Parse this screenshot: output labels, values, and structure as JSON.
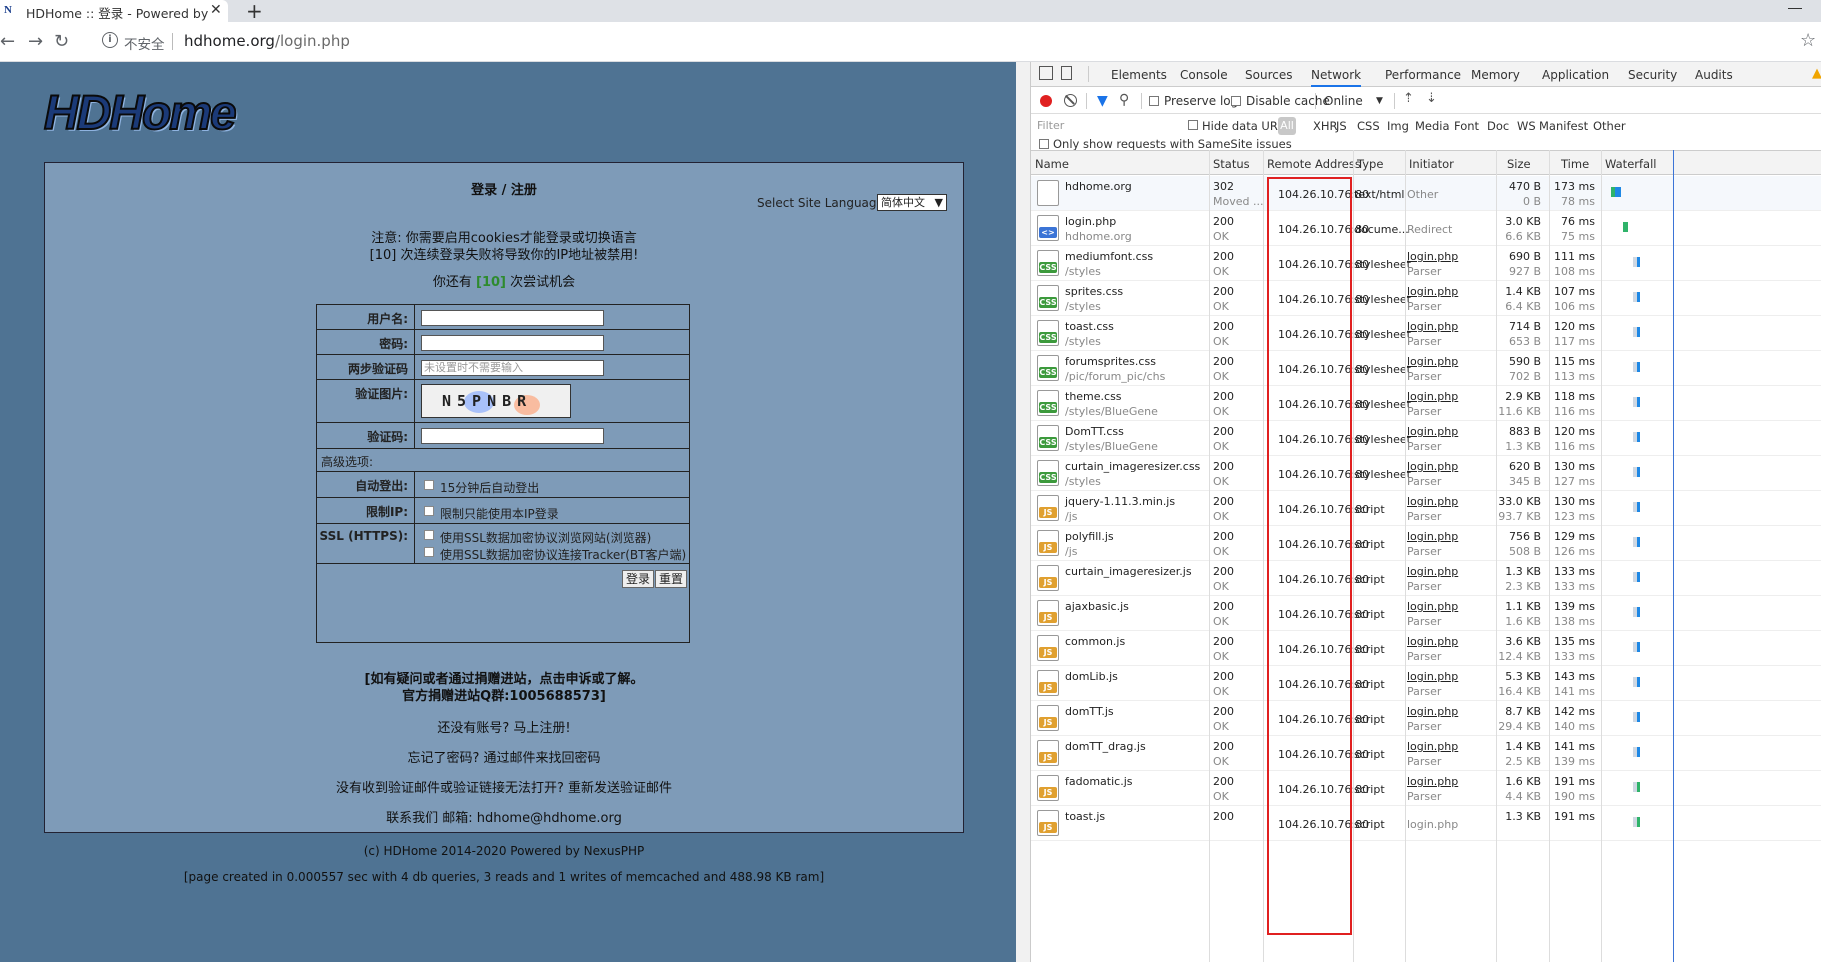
{
  "browser": {
    "tab_title": "HDHome :: 登录 - Powered by",
    "tab_close": "✕",
    "new_tab": "+",
    "security_label": "不安全",
    "url_host": "hdhome.org",
    "url_path": "/login.php"
  },
  "page": {
    "logo_text": "HDHome",
    "heading": "登录 / 注册",
    "lang_label": "Select Site Language:",
    "lang_value": "简体中文",
    "note_line1": "注意: 你需要启用cookies才能登录或切换语言",
    "note_line2": "[10] 次连续登录失败将导致你的IP地址被禁用!",
    "attempts_prefix": "你还有 ",
    "attempts_count": "[10]",
    "attempts_suffix": " 次尝试机会",
    "form": {
      "username_label": "用户名:",
      "password_label": "密码:",
      "twofa_label": "两步验证码",
      "twofa_placeholder": "未设置时不需要输入",
      "captcha_label": "验证图片:",
      "captcha_text": "N5PNBR",
      "code_label": "验证码:",
      "advanced_label": "高级选项:",
      "autologout_label": "自动登出:",
      "autologout_option": "15分钟后自动登出",
      "iplock_label": "限制IP:",
      "iplock_option": "限制只能使用本IP登录",
      "ssl_label": "SSL (HTTPS):",
      "ssl_option1": "使用SSL数据加密协议浏览网站(浏览器)",
      "ssl_option2": "使用SSL数据加密协议连接Tracker(BT客户端)",
      "login_button": "登录",
      "reset_button": "重置"
    },
    "appeal_line1": "[如有疑问或者通过捐赠进站，点击申诉或了解。",
    "appeal_line2": "官方捐赠进站Q群:1005688573]",
    "register_text": "还没有账号? 马上注册!",
    "forgot_text": "忘记了密码? 通过邮件来找回密码",
    "resend_text": "没有收到验证邮件或验证链接无法打开? 重新发送验证邮件",
    "contact_text": "联系我们 邮箱: hdhome@hdhome.org",
    "copyright": "(c) HDHome 2014-2020 Powered by NexusPHP",
    "page_stats": "[page created in 0.000557 sec with 4 db queries, 3 reads and 1 writes of memcached and 488.98 KB ram]"
  },
  "devtools": {
    "tabs": [
      "Elements",
      "Console",
      "Sources",
      "Network",
      "Performance",
      "Memory",
      "Application",
      "Security",
      "Audits"
    ],
    "active_tab": "Network",
    "toolbar": {
      "preserve_log": "Preserve log",
      "disable_cache": "Disable cache",
      "throttle": "Online"
    },
    "filter": {
      "placeholder": "Filter",
      "hide_data_urls": "Hide data URLs",
      "types": [
        "All",
        "XHR",
        "JS",
        "CSS",
        "Img",
        "Media",
        "Font",
        "Doc",
        "WS",
        "Manifest",
        "Other"
      ],
      "samesite": "Only show requests with SameSite issues"
    },
    "columns": [
      "Name",
      "Status",
      "Remote Address",
      "Type",
      "Initiator",
      "Size",
      "Time",
      "Waterfall"
    ],
    "requests": [
      {
        "name": "hdhome.org",
        "path": "",
        "status": "302",
        "status_text": "Moved ...",
        "addr": "104.26.10.76:80",
        "type": "text/html",
        "initiator": "Other",
        "initiator_sub": "",
        "size1": "470 B",
        "size2": "0 B",
        "time1": "173 ms",
        "time2": "78 ms",
        "icon": "doc",
        "wf": 0.02
      },
      {
        "name": "login.php",
        "path": "hdhome.org",
        "status": "200",
        "status_text": "OK",
        "addr": "104.26.10.76:80",
        "type": "docume...",
        "initiator": "Redirect",
        "initiator_sub": "",
        "size1": "3.0 KB",
        "size2": "6.6 KB",
        "time1": "76 ms",
        "time2": "75 ms",
        "icon": "html",
        "wf": 0.18
      },
      {
        "name": "mediumfont.css",
        "path": "/styles",
        "status": "200",
        "status_text": "OK",
        "addr": "104.26.10.76:80",
        "type": "stylesheet",
        "initiator": "login.php",
        "initiator_sub": "Parser",
        "size1": "690 B",
        "size2": "927 B",
        "time1": "111 ms",
        "time2": "108 ms",
        "icon": "css",
        "wf": 0.3
      },
      {
        "name": "sprites.css",
        "path": "/styles",
        "status": "200",
        "status_text": "OK",
        "addr": "104.26.10.76:80",
        "type": "stylesheet",
        "initiator": "login.php",
        "initiator_sub": "Parser",
        "size1": "1.4 KB",
        "size2": "6.4 KB",
        "time1": "107 ms",
        "time2": "106 ms",
        "icon": "css",
        "wf": 0.3
      },
      {
        "name": "toast.css",
        "path": "/styles",
        "status": "200",
        "status_text": "OK",
        "addr": "104.26.10.76:80",
        "type": "stylesheet",
        "initiator": "login.php",
        "initiator_sub": "Parser",
        "size1": "714 B",
        "size2": "653 B",
        "time1": "120 ms",
        "time2": "117 ms",
        "icon": "css",
        "wf": 0.3
      },
      {
        "name": "forumsprites.css",
        "path": "/pic/forum_pic/chs",
        "status": "200",
        "status_text": "OK",
        "addr": "104.26.10.76:80",
        "type": "stylesheet",
        "initiator": "login.php",
        "initiator_sub": "Parser",
        "size1": "590 B",
        "size2": "702 B",
        "time1": "115 ms",
        "time2": "113 ms",
        "icon": "css",
        "wf": 0.3
      },
      {
        "name": "theme.css",
        "path": "/styles/BlueGene",
        "status": "200",
        "status_text": "OK",
        "addr": "104.26.10.76:80",
        "type": "stylesheet",
        "initiator": "login.php",
        "initiator_sub": "Parser",
        "size1": "2.9 KB",
        "size2": "11.6 KB",
        "time1": "118 ms",
        "time2": "116 ms",
        "icon": "css",
        "wf": 0.3
      },
      {
        "name": "DomTT.css",
        "path": "/styles/BlueGene",
        "status": "200",
        "status_text": "OK",
        "addr": "104.26.10.76:80",
        "type": "stylesheet",
        "initiator": "login.php",
        "initiator_sub": "Parser",
        "size1": "883 B",
        "size2": "1.3 KB",
        "time1": "120 ms",
        "time2": "116 ms",
        "icon": "css",
        "wf": 0.3
      },
      {
        "name": "curtain_imageresizer.css",
        "path": "/styles",
        "status": "200",
        "status_text": "OK",
        "addr": "104.26.10.76:80",
        "type": "stylesheet",
        "initiator": "login.php",
        "initiator_sub": "Parser",
        "size1": "620 B",
        "size2": "345 B",
        "time1": "130 ms",
        "time2": "127 ms",
        "icon": "css",
        "wf": 0.3
      },
      {
        "name": "jquery-1.11.3.min.js",
        "path": "/js",
        "status": "200",
        "status_text": "OK",
        "addr": "104.26.10.76:80",
        "type": "script",
        "initiator": "login.php",
        "initiator_sub": "Parser",
        "size1": "33.0 KB",
        "size2": "93.7 KB",
        "time1": "130 ms",
        "time2": "123 ms",
        "icon": "js",
        "wf": 0.3
      },
      {
        "name": "polyfill.js",
        "path": "/js",
        "status": "200",
        "status_text": "OK",
        "addr": "104.26.10.76:80",
        "type": "script",
        "initiator": "login.php",
        "initiator_sub": "Parser",
        "size1": "756 B",
        "size2": "508 B",
        "time1": "129 ms",
        "time2": "126 ms",
        "icon": "js",
        "wf": 0.3
      },
      {
        "name": "curtain_imageresizer.js",
        "path": "",
        "status": "200",
        "status_text": "OK",
        "addr": "104.26.10.76:80",
        "type": "script",
        "initiator": "login.php",
        "initiator_sub": "Parser",
        "size1": "1.3 KB",
        "size2": "2.3 KB",
        "time1": "133 ms",
        "time2": "133 ms",
        "icon": "js",
        "wf": 0.3
      },
      {
        "name": "ajaxbasic.js",
        "path": "",
        "status": "200",
        "status_text": "OK",
        "addr": "104.26.10.76:80",
        "type": "script",
        "initiator": "login.php",
        "initiator_sub": "Parser",
        "size1": "1.1 KB",
        "size2": "1.6 KB",
        "time1": "139 ms",
        "time2": "138 ms",
        "icon": "js",
        "wf": 0.3
      },
      {
        "name": "common.js",
        "path": "",
        "status": "200",
        "status_text": "OK",
        "addr": "104.26.10.76:80",
        "type": "script",
        "initiator": "login.php",
        "initiator_sub": "Parser",
        "size1": "3.6 KB",
        "size2": "12.4 KB",
        "time1": "135 ms",
        "time2": "133 ms",
        "icon": "js",
        "wf": 0.3
      },
      {
        "name": "domLib.js",
        "path": "",
        "status": "200",
        "status_text": "OK",
        "addr": "104.26.10.76:80",
        "type": "script",
        "initiator": "login.php",
        "initiator_sub": "Parser",
        "size1": "5.3 KB",
        "size2": "16.4 KB",
        "time1": "143 ms",
        "time2": "141 ms",
        "icon": "js",
        "wf": 0.3
      },
      {
        "name": "domTT.js",
        "path": "",
        "status": "200",
        "status_text": "OK",
        "addr": "104.26.10.76:80",
        "type": "script",
        "initiator": "login.php",
        "initiator_sub": "Parser",
        "size1": "8.7 KB",
        "size2": "29.4 KB",
        "time1": "142 ms",
        "time2": "140 ms",
        "icon": "js",
        "wf": 0.3
      },
      {
        "name": "domTT_drag.js",
        "path": "",
        "status": "200",
        "status_text": "OK",
        "addr": "104.26.10.76:80",
        "type": "script",
        "initiator": "login.php",
        "initiator_sub": "Parser",
        "size1": "1.4 KB",
        "size2": "2.5 KB",
        "time1": "141 ms",
        "time2": "139 ms",
        "icon": "js",
        "wf": 0.3
      },
      {
        "name": "fadomatic.js",
        "path": "",
        "status": "200",
        "status_text": "OK",
        "addr": "104.26.10.76:80",
        "type": "script",
        "initiator": "login.php",
        "initiator_sub": "Parser",
        "size1": "1.6 KB",
        "size2": "4.4 KB",
        "time1": "191 ms",
        "time2": "190 ms",
        "icon": "js",
        "wf": 0.3
      },
      {
        "name": "toast.js",
        "path": "",
        "status": "200",
        "status_text": "",
        "addr": "104.26.10.76:80",
        "type": "script",
        "initiator": "login.php",
        "initiator_sub": "",
        "size1": "1.3 KB",
        "size2": "",
        "time1": "191 ms",
        "time2": "",
        "icon": "js",
        "wf": 0.3
      }
    ],
    "colors": {
      "record": "#e02020",
      "highlight_box": "#e02020",
      "css_badge": "#3c9a3c",
      "js_badge": "#e0a030"
    }
  }
}
